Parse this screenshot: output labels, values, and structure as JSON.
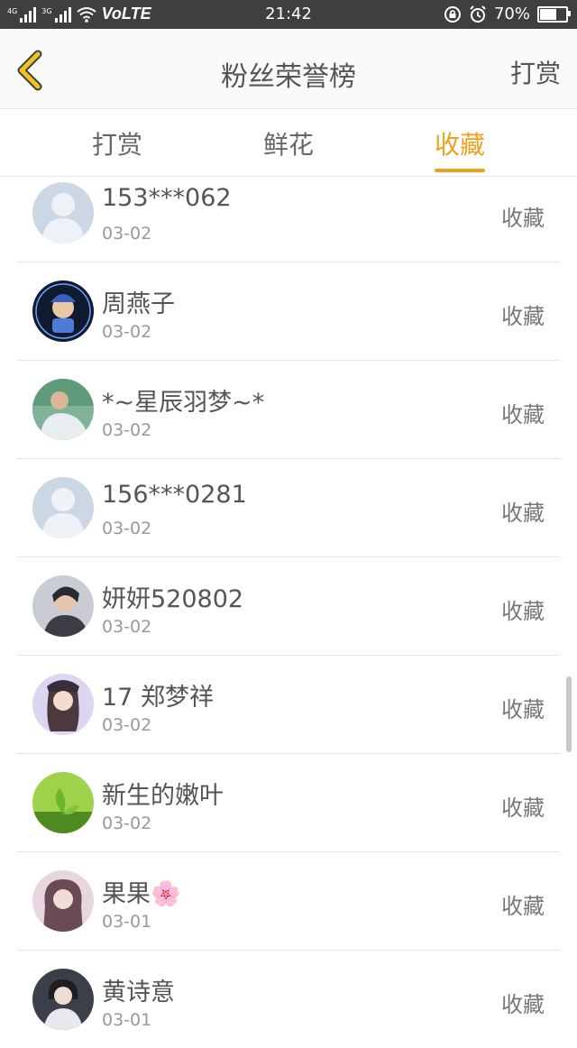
{
  "status_bar": {
    "network_left": "4G",
    "network_right": "3G",
    "volte": "VoLTE",
    "time": "21:42",
    "battery_pct": "70%",
    "battery_level": 0.7
  },
  "header": {
    "back_icon": "chevron-left-icon",
    "title": "粉丝荣誉榜",
    "right_action": "打赏"
  },
  "tabs": [
    {
      "label": "打赏",
      "active": false
    },
    {
      "label": "鲜花",
      "active": false
    },
    {
      "label": "收藏",
      "active": true
    }
  ],
  "accent_color": "#f0a01c",
  "fans": [
    {
      "name": "153***062",
      "date": "03-02",
      "action": "收藏",
      "avatar": "default-user"
    },
    {
      "name": "周燕子",
      "date": "03-02",
      "action": "收藏",
      "avatar": "cartoon-boy-dark"
    },
    {
      "name": "*~星辰羽梦~*",
      "date": "03-02",
      "action": "收藏",
      "avatar": "person-green-photo"
    },
    {
      "name": "156***0281",
      "date": "03-02",
      "action": "收藏",
      "avatar": "default-user"
    },
    {
      "name": "妍妍520802",
      "date": "03-02",
      "action": "收藏",
      "avatar": "portrait-photo"
    },
    {
      "name": "17 郑梦祥",
      "date": "03-02",
      "action": "收藏",
      "avatar": "anime-girl"
    },
    {
      "name": "新生的嫩叶",
      "date": "03-02",
      "action": "收藏",
      "avatar": "green-leaf"
    },
    {
      "name": "果果🌸",
      "date": "03-01",
      "action": "收藏",
      "avatar": "girl-pink-photo"
    },
    {
      "name": "黄诗意",
      "date": "03-01",
      "action": "收藏",
      "avatar": "girl-dark-photo"
    }
  ]
}
